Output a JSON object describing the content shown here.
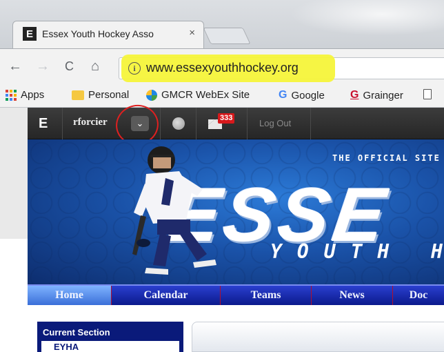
{
  "browser": {
    "tab": {
      "title": "Essex Youth Hockey Asso",
      "favicon_letter": "E",
      "close_label": "×"
    },
    "nav": {
      "back": "←",
      "forward": "→",
      "reload": "C",
      "home": "⌂"
    },
    "address": {
      "info_icon": "i",
      "url": "www.essexyouthhockey.org"
    },
    "bookmarks": [
      {
        "label": "Apps",
        "icon": "apps-grid-icon"
      },
      {
        "label": "Personal",
        "icon": "folder-icon"
      },
      {
        "label": "GMCR WebEx Site",
        "icon": "globe-icon"
      },
      {
        "label": "Google",
        "icon": "google-icon",
        "glyph": "G"
      },
      {
        "label": "Grainger",
        "icon": "grainger-icon",
        "glyph": "G"
      },
      {
        "label": "",
        "icon": "document-icon"
      }
    ]
  },
  "site": {
    "topbar": {
      "logo": "E",
      "username": "rforcier",
      "dropdown_glyph": "⌄",
      "mail_count": "333",
      "logout_label": "Log Out"
    },
    "banner": {
      "tagline": "THE OFFICIAL SITE",
      "headline": "ESSE",
      "subline": "YOUTH HO"
    },
    "nav": [
      "Home",
      "Calendar",
      "Teams",
      "News",
      "Doc"
    ],
    "sidebar": {
      "title": "Current Section",
      "item": "EYHA"
    }
  },
  "colors": {
    "highlight": "#f6f43a",
    "annotation_circle": "#e02020",
    "nav_blue": "#0b1a8c",
    "banner_blue": "#1a52a8",
    "badge_red": "#d7191c"
  }
}
